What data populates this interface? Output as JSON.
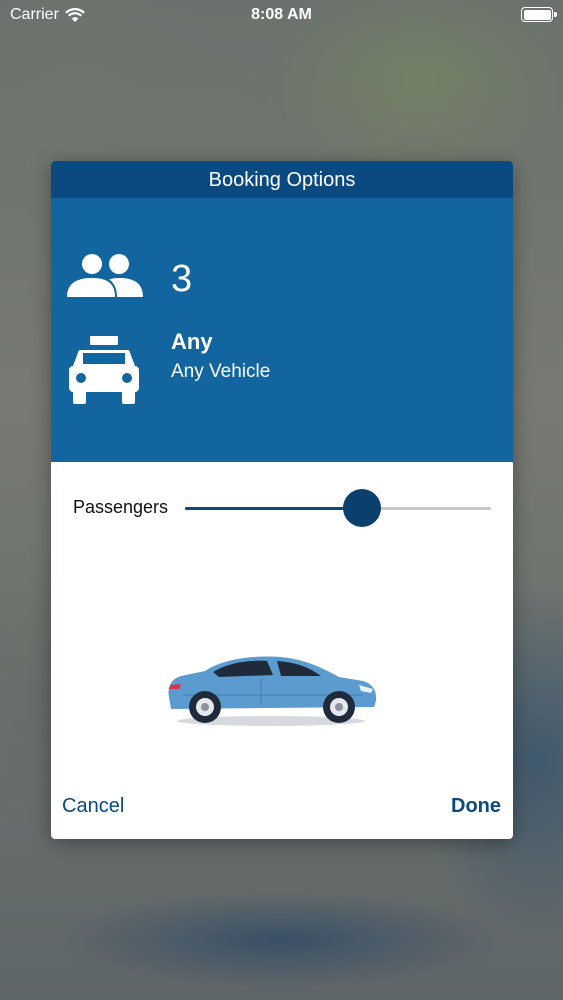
{
  "status_bar": {
    "carrier": "Carrier",
    "time": "8:08 AM"
  },
  "dialog": {
    "title": "Booking Options",
    "passengers": {
      "count": "3",
      "icon": "people-icon"
    },
    "vehicle": {
      "title": "Any",
      "subtitle": "Any Vehicle",
      "icon": "taxi-icon"
    },
    "slider": {
      "label": "Passengers",
      "level": 0.58
    },
    "car_illustration": "car-icon",
    "cancel_label": "Cancel",
    "done_label": "Done"
  },
  "colors": {
    "header": "#0b4a80",
    "summary_bg": "#12659e",
    "accent": "#0b3f6e",
    "car": "#5b9bd0"
  }
}
